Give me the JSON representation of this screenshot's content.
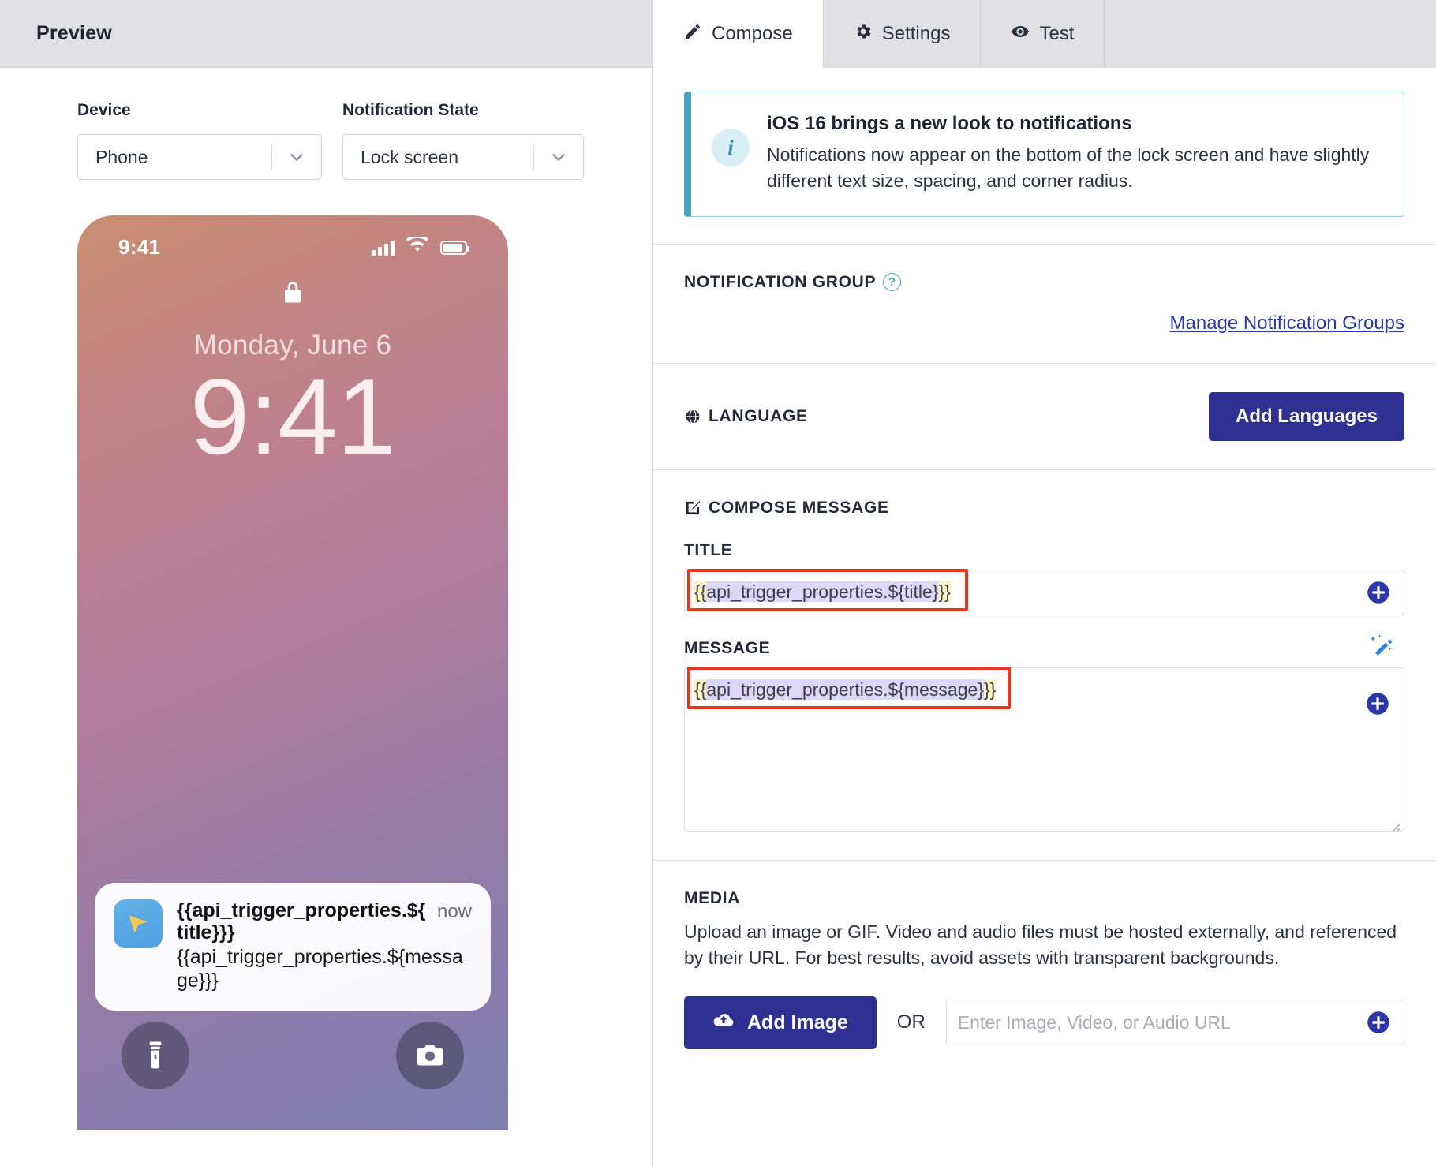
{
  "preview": {
    "header_title": "Preview",
    "device": {
      "label": "Device",
      "value": "Phone",
      "caret_icon": "chevron-down-icon"
    },
    "notification_state": {
      "label": "Notification State",
      "value": "Lock screen",
      "caret_icon": "chevron-down-icon"
    },
    "phone": {
      "status_time": "9:41",
      "signal_icon": "cellular-bars-icon",
      "wifi_icon": "wifi-icon",
      "battery_icon": "battery-icon",
      "lock_icon": "lock-icon",
      "date": "Monday, June 6",
      "big_time": "9:41",
      "notification": {
        "app_icon": "cursor-arrow-app-icon",
        "title": "{{api_trigger_properties.${title}}}",
        "message": "{{api_trigger_properties.${message}}}",
        "timestamp": "now"
      },
      "flashlight_icon": "flashlight-icon",
      "camera_icon": "camera-icon"
    }
  },
  "tabs": [
    {
      "label": "Compose",
      "icon": "pencil-icon",
      "active": true
    },
    {
      "label": "Settings",
      "icon": "gear-icon",
      "active": false
    },
    {
      "label": "Test",
      "icon": "eye-icon",
      "active": false
    }
  ],
  "banner": {
    "icon": "info-icon",
    "title": "iOS 16 brings a new look to notifications",
    "body": "Notifications now appear on the bottom of the lock screen and have slightly different text size, spacing, and corner radius.",
    "accent_color": "#48a3bd"
  },
  "notification_group": {
    "heading": "NOTIFICATION GROUP",
    "help_icon": "question-mark-icon",
    "manage_link": "Manage Notification Groups"
  },
  "language": {
    "heading": "LANGUAGE",
    "icon": "globe-icon",
    "add_button": "Add Languages"
  },
  "compose_message": {
    "heading": "COMPOSE MESSAGE",
    "icon": "compose-pencil-icon",
    "title_label": "TITLE",
    "title_value": "{{api_trigger_properties.${title}}}",
    "title_value_parts": {
      "open": "{{",
      "inner": "api_trigger_properties.${title}",
      "close": "}}"
    },
    "message_label": "MESSAGE",
    "message_value": "{{api_trigger_properties.${message}}}",
    "message_value_parts": {
      "open": "{{",
      "inner": "api_trigger_properties.${message}",
      "close": "}}"
    },
    "add_icon": "plus-circle-icon",
    "wand_icon": "magic-wand-icon",
    "resize_icon": "resize-handle-icon"
  },
  "media": {
    "heading": "MEDIA",
    "description": "Upload an image or GIF. Video and audio files must be hosted externally, and referenced by their URL. For best results, avoid assets with transparent backgrounds.",
    "add_image_button": "Add Image",
    "upload_icon": "cloud-upload-icon",
    "or_text": "OR",
    "url_placeholder": "Enter Image, Video, or Audio URL",
    "url_value": "",
    "add_icon": "plus-circle-icon"
  },
  "colors": {
    "brand_blue": "#2e3192",
    "link_blue": "#2b37a8",
    "annotation_red": "#e8361d",
    "info_teal": "#48a3bd",
    "token_brace_bg": "#fdf3c4",
    "token_inner_bg": "#ded7f7"
  }
}
